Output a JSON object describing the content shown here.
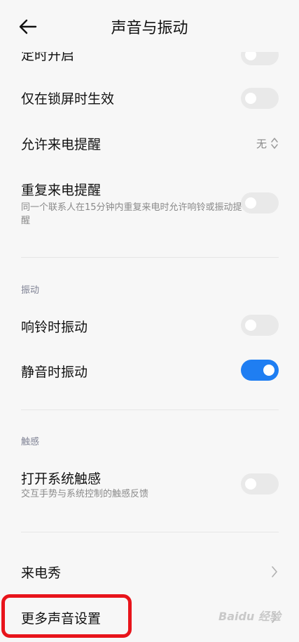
{
  "header": {
    "title": "声音与振动"
  },
  "rows": {
    "timed_on": {
      "label": "定时开启"
    },
    "lockscreen_only": {
      "label": "仅在锁屏时生效"
    },
    "allow_calls": {
      "label": "允许来电提醒",
      "value": "无"
    },
    "repeat_calls": {
      "label": "重复来电提醒",
      "desc": "同一个联系人在15分钟内重复来电时允许响铃或振动提醒"
    },
    "vibrate_ring": {
      "label": "响铃时振动"
    },
    "vibrate_silent": {
      "label": "静音时振动"
    },
    "haptics": {
      "label": "打开系统触感",
      "desc": "交互手势与系统控制的触感反馈"
    },
    "caller_show": {
      "label": "来电秀"
    },
    "more_sound": {
      "label": "更多声音设置"
    }
  },
  "sections": {
    "vibration": "振动",
    "haptics": "触感"
  },
  "toggles": {
    "timed_on": false,
    "lockscreen_only": false,
    "repeat_calls": false,
    "vibrate_ring": false,
    "vibrate_silent": true,
    "haptics": false
  },
  "watermark": "Baidu 经验",
  "colors": {
    "toggle_on": "#1f7ef2",
    "toggle_off": "#e9e9e9",
    "highlight": "#e8141b"
  }
}
